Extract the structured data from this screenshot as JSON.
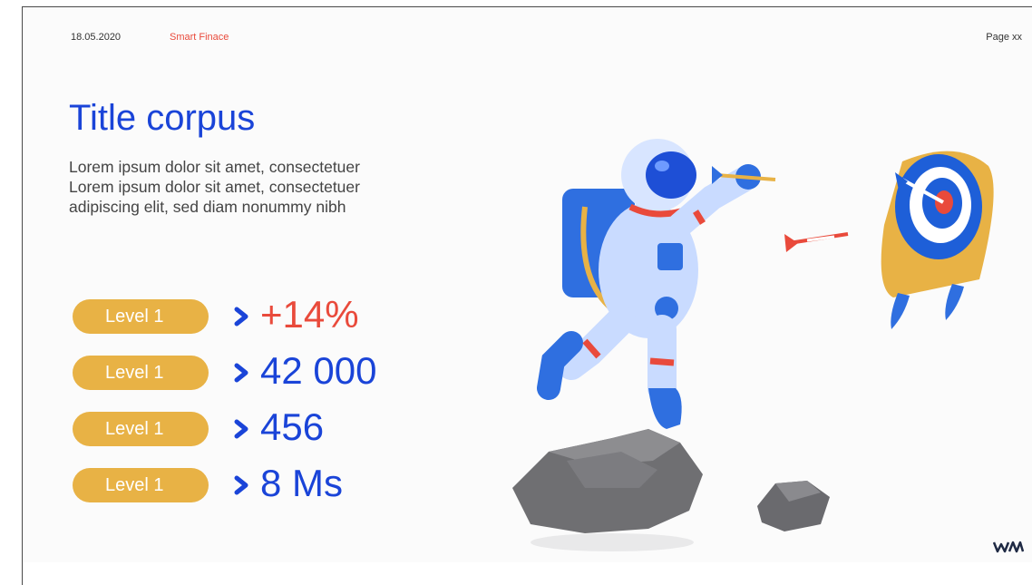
{
  "header": {
    "date": "18.05.2020",
    "brand": "Smart Finace",
    "page": "Page xx"
  },
  "title": "Title corpus",
  "body_lines": [
    "Lorem ipsum dolor sit amet, consectetuer",
    "Lorem ipsum dolor sit amet, consectetuer",
    "adipiscing elit, sed diam nonummy nibh"
  ],
  "kpis": [
    {
      "label": "Level 1",
      "value": "+14%",
      "color": "#e94a3b"
    },
    {
      "label": "Level 1",
      "value": "42 000",
      "color": "#1a44d8"
    },
    {
      "label": "Level 1",
      "value": "456",
      "color": "#1a44d8"
    },
    {
      "label": "Level 1",
      "value": "8 Ms",
      "color": "#1a44d8"
    }
  ],
  "colors": {
    "accent_blue": "#1a44d8",
    "accent_red": "#e94a3b",
    "pill_yellow": "#e8b245"
  },
  "icons": [
    "chevron-right-icon",
    "wm-logo-icon",
    "astronaut-illustration",
    "target-illustration",
    "dart-illustration",
    "rock-illustration"
  ]
}
